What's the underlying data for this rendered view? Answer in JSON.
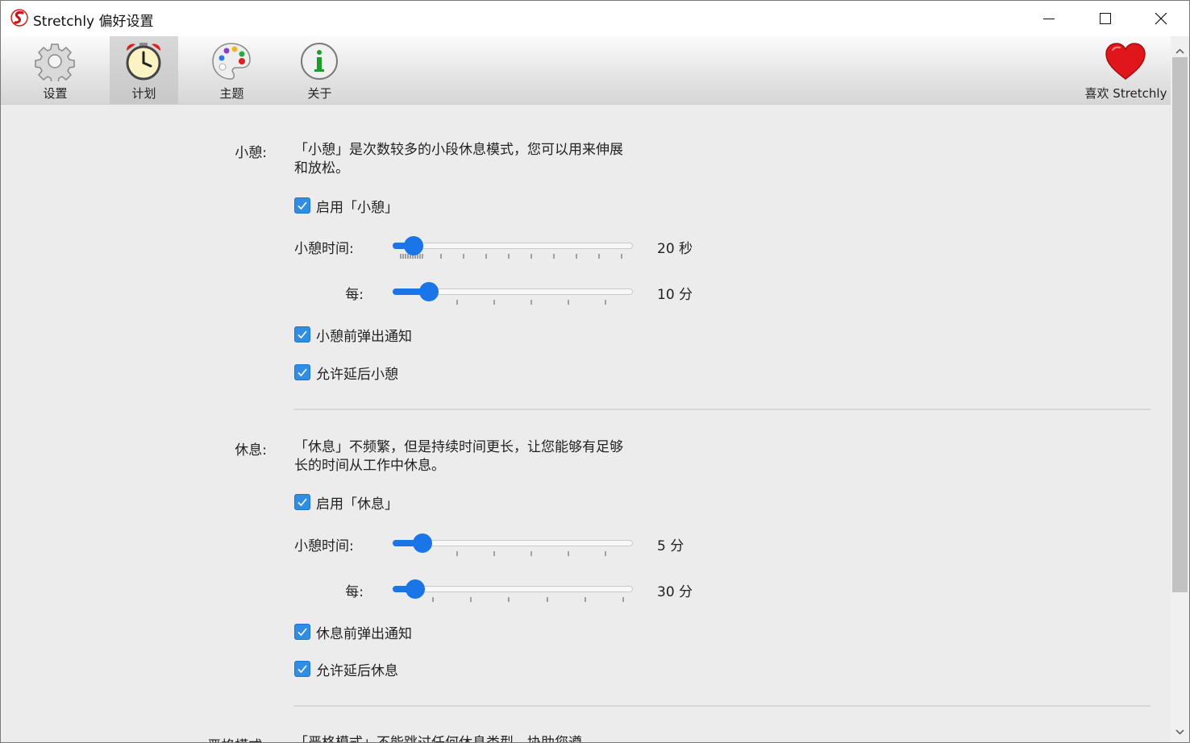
{
  "window": {
    "title": "Stretchly 偏好设置"
  },
  "toolbar": {
    "items": [
      {
        "label": "设置",
        "icon": "gear-icon"
      },
      {
        "label": "计划",
        "icon": "alarm-clock-icon",
        "active": true
      },
      {
        "label": "主题",
        "icon": "palette-icon"
      },
      {
        "label": "关于",
        "icon": "info-icon"
      }
    ],
    "love_label": "喜欢 Stretchly"
  },
  "microbreak": {
    "label": "小憩:",
    "description": "「小憩」是次数较多的小段休息模式，您可以用来伸展和放松。",
    "enable_label": "启用「小憩」",
    "enable_checked": true,
    "duration_label": "小憩时间:",
    "duration_value": "20 秒",
    "duration_fraction": 0.05,
    "interval_label": "每:",
    "interval_value": "10 分",
    "interval_fraction": 0.12,
    "notify_label": "小憩前弹出通知",
    "notify_checked": true,
    "postpone_label": "允许延后小憩",
    "postpone_checked": true
  },
  "break": {
    "label": "休息:",
    "description": "「休息」不频繁，但是持续时间更长，让您能够有足够长的时间从工作中休息。",
    "enable_label": "启用「休息」",
    "enable_checked": true,
    "duration_label": "小憩时间:",
    "duration_value": "5 分",
    "duration_fraction": 0.09,
    "interval_label": "每:",
    "interval_value": "30 分",
    "interval_fraction": 0.06,
    "notify_label": "休息前弹出通知",
    "notify_checked": true,
    "postpone_label": "允许延后休息",
    "postpone_checked": true
  },
  "strict": {
    "label": "严格模式:",
    "description": "「严格模式」不能跳过任何休息类型，协助您遵"
  },
  "colors": {
    "accent": "#1a75e8",
    "checkbox": "#2f8de4",
    "heart": "#e0161b"
  }
}
